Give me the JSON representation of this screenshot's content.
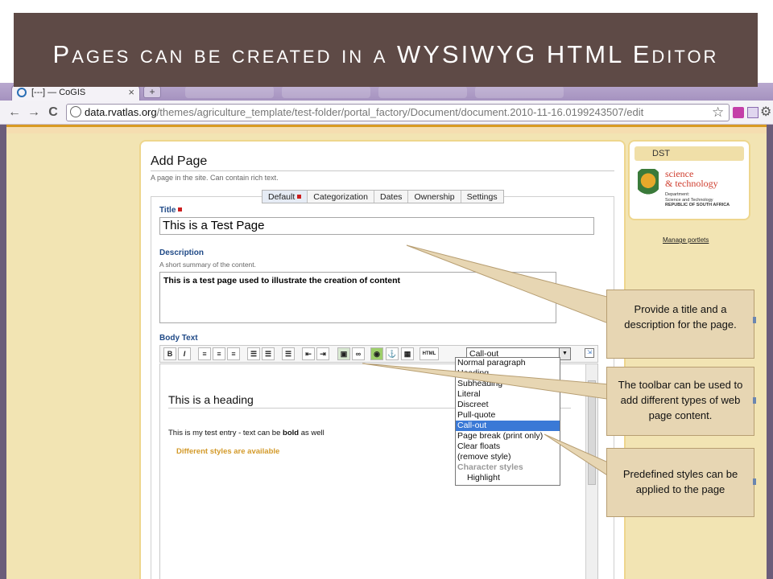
{
  "slide": {
    "title": "Pages can be created in a WYSIWYG HTML Editor"
  },
  "browser": {
    "tab_title": "[---] — CoGIS",
    "tab_close": "×",
    "new_tab": "+",
    "url_host": "data.rvatlas.org",
    "url_path": "/themes/agriculture_template/test-folder/portal_factory/Document/document.2010-11-16.0199243507/edit",
    "back_icon": "←",
    "forward_icon": "→",
    "reload_icon": "C",
    "star_icon": "☆",
    "wrench_icon": "🔧"
  },
  "page": {
    "heading": "Add Page",
    "subtitle": "A page in the site. Can contain rich text.",
    "tabs": [
      {
        "label": "Default",
        "active": true
      },
      {
        "label": "Categorization",
        "active": false
      },
      {
        "label": "Dates",
        "active": false
      },
      {
        "label": "Ownership",
        "active": false
      },
      {
        "label": "Settings",
        "active": false
      }
    ],
    "title_label": "Title",
    "title_value": "This is a Test Page",
    "description_label": "Description",
    "description_help": "A short summary of the content.",
    "description_value": "This is a test page used to illustrate the creation of content",
    "body_label": "Body Text"
  },
  "editor": {
    "buttons": {
      "bold": "B",
      "italic": "I",
      "html": "HTML"
    },
    "style_selected": "Call-out",
    "style_options": [
      {
        "label": "Normal paragraph",
        "kind": "item"
      },
      {
        "label": "Heading",
        "kind": "item"
      },
      {
        "label": "Subheading",
        "kind": "item"
      },
      {
        "label": "Literal",
        "kind": "item"
      },
      {
        "label": "Discreet",
        "kind": "item"
      },
      {
        "label": "Pull-quote",
        "kind": "item"
      },
      {
        "label": "Call-out",
        "kind": "selected"
      },
      {
        "label": "Page break (print only)",
        "kind": "item"
      },
      {
        "label": "Clear floats",
        "kind": "item"
      },
      {
        "label": "(remove style)",
        "kind": "item"
      },
      {
        "label": "Character styles",
        "kind": "group"
      },
      {
        "label": "Highlight",
        "kind": "indent"
      }
    ],
    "content_heading": "This is a heading",
    "content_para_before": "This is my test entry - text can be ",
    "content_para_bold": "bold",
    "content_para_after": " as well",
    "content_callout": "Different styles are available"
  },
  "portlet": {
    "head_label": "DST",
    "logo_line1": "science",
    "logo_line2": "& technology",
    "logo_dept1": "Department:",
    "logo_dept2": "Science and Technology",
    "logo_dept3": "REPUBLIC OF SOUTH AFRICA",
    "manage_link": "Manage portlets"
  },
  "callouts": {
    "title_desc": "Provide a title and a description for the page.",
    "toolbar": "The toolbar can be used to add different types of web page content.",
    "styles": "Predefined styles can be applied to the page"
  },
  "colors": {
    "title_band": "#5e4a46",
    "page_bg": "#f2e4b3",
    "callout_bg": "#e7d6b3",
    "selected_item": "#3a79d6"
  }
}
